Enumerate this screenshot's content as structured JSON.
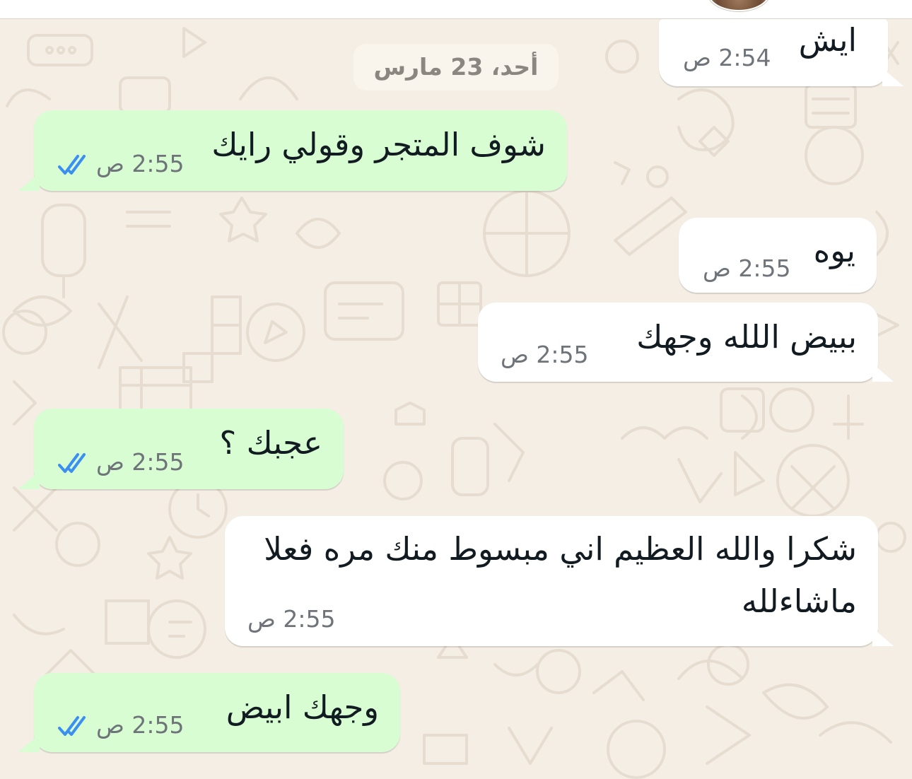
{
  "date_separator": "أحد، 23 مارس",
  "tick_color": "#3b8ff0",
  "colors": {
    "incoming_bubble": "#ffffff",
    "outgoing_bubble": "#d8fdd2",
    "wallpaper": "#f4eee5"
  },
  "messages": [
    {
      "direction": "incoming",
      "text": "ايش",
      "time": "2:54 ص"
    },
    {
      "direction": "outgoing",
      "text": "شوف المتجر وقولي رايك",
      "time": "2:55 ص",
      "status": "read"
    },
    {
      "direction": "incoming",
      "text": "يوه",
      "time": "2:55 ص"
    },
    {
      "direction": "incoming",
      "text": "ببيض اللله وجهك",
      "time": "2:55 ص"
    },
    {
      "direction": "outgoing",
      "text": "عجبك ؟",
      "time": "2:55 ص",
      "status": "read"
    },
    {
      "direction": "incoming",
      "lines": [
        "شكرا والله العظيم اني مبسوط منك مره فعلا",
        "ماشاءلله"
      ],
      "time": "2:55 ص"
    },
    {
      "direction": "outgoing",
      "text": "وجهك ابيض",
      "time": "2:55 ص",
      "status": "read"
    }
  ]
}
